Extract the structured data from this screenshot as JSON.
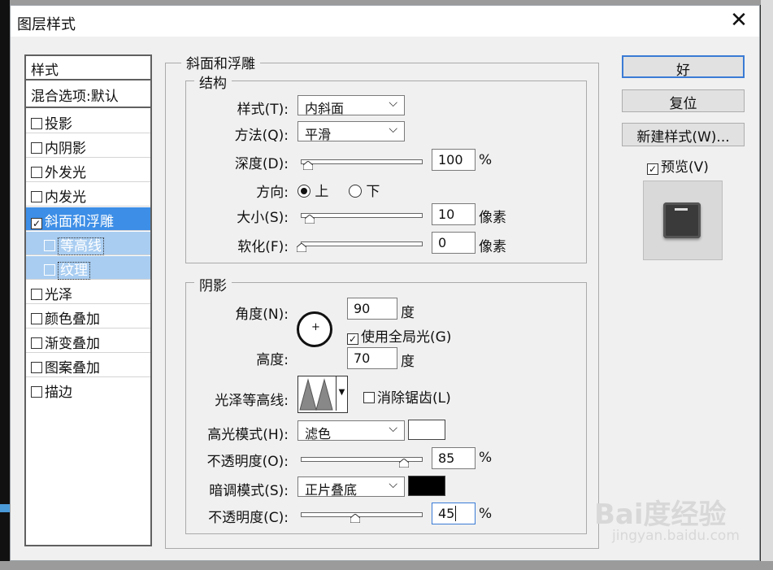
{
  "dialog": {
    "title": "图层样式",
    "close_glyph": "✕"
  },
  "styles_list": {
    "header": "样式",
    "blend": "混合选项:默认",
    "items": [
      {
        "label": "投影",
        "checked": false
      },
      {
        "label": "内阴影",
        "checked": false
      },
      {
        "label": "外发光",
        "checked": false
      },
      {
        "label": "内发光",
        "checked": false
      },
      {
        "label": "斜面和浮雕",
        "checked": true,
        "selected": true
      },
      {
        "label": "等高线",
        "checked": false,
        "sub": true
      },
      {
        "label": "纹理",
        "checked": false,
        "sub": true
      },
      {
        "label": "光泽",
        "checked": false
      },
      {
        "label": "颜色叠加",
        "checked": false
      },
      {
        "label": "渐变叠加",
        "checked": false
      },
      {
        "label": "图案叠加",
        "checked": false
      },
      {
        "label": "描边",
        "checked": false
      }
    ]
  },
  "bevel": {
    "section_title": "斜面和浮雕",
    "structure": {
      "legend": "结构",
      "style_label": "样式(T):",
      "style_value": "内斜面",
      "method_label": "方法(Q):",
      "method_value": "平滑",
      "depth_label": "深度(D):",
      "depth_value": "100",
      "depth_unit": "%",
      "depth_slider": 0.1,
      "direction_label": "方向:",
      "dir_up": "上",
      "dir_down": "下",
      "direction_selected": "上",
      "size_label": "大小(S):",
      "size_value": "10",
      "size_unit": "像素",
      "size_slider": 0.07,
      "soften_label": "软化(F):",
      "soften_value": "0",
      "soften_unit": "像素",
      "soften_slider": 0.0
    },
    "shading": {
      "legend": "阴影",
      "angle_label": "角度(N):",
      "angle_value": "90",
      "angle_unit": "度",
      "global_light_label": "使用全局光(G)",
      "global_light_checked": true,
      "altitude_label": "高度:",
      "altitude_value": "70",
      "altitude_unit": "度",
      "gloss_contour_label": "光泽等高线:",
      "anti_alias_label": "消除锯齿(L)",
      "anti_alias_checked": false,
      "highlight_mode_label": "高光模式(H):",
      "highlight_mode_value": "滤色",
      "highlight_color": "#ffffff",
      "highlight_opacity_label": "不透明度(O):",
      "highlight_opacity_value": "85",
      "highlight_opacity_unit": "%",
      "highlight_opacity_slider": 0.85,
      "shadow_mode_label": "暗调模式(S):",
      "shadow_mode_value": "正片叠底",
      "shadow_color": "#000000",
      "shadow_opacity_label": "不透明度(C):",
      "shadow_opacity_value": "45",
      "shadow_opacity_unit": "%",
      "shadow_opacity_slider": 0.45
    }
  },
  "buttons": {
    "ok": "好",
    "reset": "复位",
    "new_style": "新建样式(W)...",
    "preview_label": "预览(V)",
    "preview_checked": true
  },
  "watermark": {
    "logo": "Bai度经验",
    "url": "jingyan.baidu.com"
  }
}
